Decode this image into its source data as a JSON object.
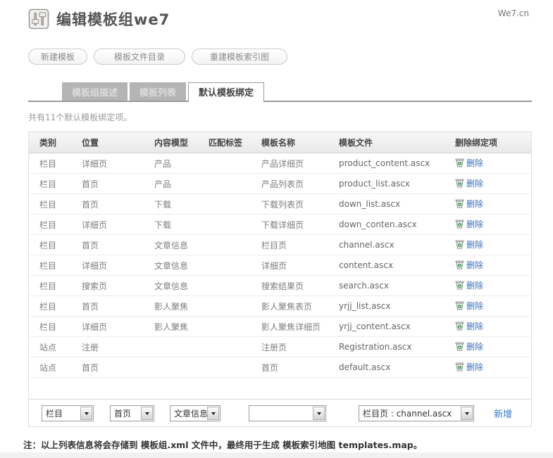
{
  "header": {
    "title": "编辑模板组we7",
    "brand": "We7.cn",
    "icon": "sliders-icon"
  },
  "toolbar": {
    "buttons": [
      {
        "label": "新建模板"
      },
      {
        "label": "模板文件目录"
      },
      {
        "label": "重建模板索引图"
      }
    ]
  },
  "tabs": {
    "items": [
      {
        "label": "模板组描述",
        "active": false
      },
      {
        "label": "模板列表",
        "active": false
      },
      {
        "label": "默认模板绑定",
        "active": true
      }
    ]
  },
  "summary": "共有11个默认模板绑定项。",
  "table": {
    "headers": [
      "类别",
      "位置",
      "内容模型",
      "匹配标签",
      "模板名称",
      "模板文件",
      "删除绑定项"
    ],
    "delete_label": "删除",
    "rows": [
      [
        "栏目",
        "详细页",
        "产品",
        "",
        "产品详细页",
        "product_content.ascx"
      ],
      [
        "栏目",
        "首页",
        "产品",
        "",
        "产品列表页",
        "product_list.ascx"
      ],
      [
        "栏目",
        "首页",
        "下载",
        "",
        "下载列表页",
        "down_list.ascx"
      ],
      [
        "栏目",
        "详细页",
        "下载",
        "",
        "下载详细页",
        "down_conten.ascx"
      ],
      [
        "栏目",
        "首页",
        "文章信息",
        "",
        "栏目页",
        "channel.ascx"
      ],
      [
        "栏目",
        "详细页",
        "文章信息",
        "",
        "详细页",
        "content.ascx"
      ],
      [
        "栏目",
        "搜索页",
        "文章信息",
        "",
        "搜索结果页",
        "search.ascx"
      ],
      [
        "栏目",
        "首页",
        "影人聚焦",
        "",
        "影人聚焦表页",
        "yrjj_list.ascx"
      ],
      [
        "栏目",
        "详细页",
        "影人聚焦",
        "",
        "影人聚焦详细页",
        "yrjj_content.ascx"
      ],
      [
        "站点",
        "注册",
        "",
        "",
        "注册页",
        "Registration.ascx"
      ],
      [
        "站点",
        "首页",
        "",
        "",
        "首页",
        "default.ascx"
      ]
    ]
  },
  "add_form": {
    "selects": [
      {
        "name": "category-select",
        "value": "栏目"
      },
      {
        "name": "position-select",
        "value": "首页"
      },
      {
        "name": "content-model-select",
        "value": "文章信息"
      },
      {
        "name": "match-tag-select",
        "value": ""
      },
      {
        "name": "template-select",
        "value": "栏目页 : channel.ascx"
      }
    ],
    "add_label": "新增"
  },
  "footnote": "注：以上列表信息将会存储到 模板组.xml 文件中，最终用于生成 模板索引地图 templates.map。",
  "colors": {
    "link_blue": "#3b6fbb",
    "add_link_blue": "#2e7ad2",
    "tab_inactive_bg": "#b4b4b4",
    "tab_active_text": "#444444",
    "recycle_green": "#2f9e4e"
  }
}
